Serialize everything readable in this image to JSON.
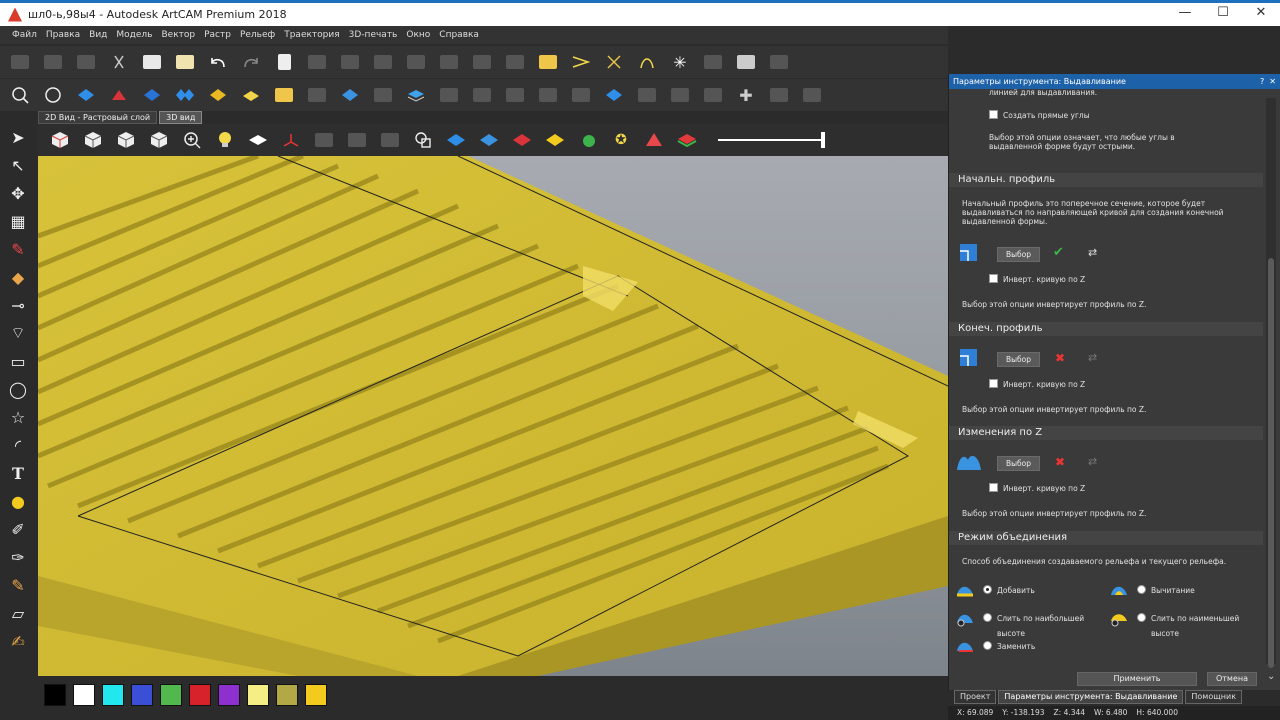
{
  "window": {
    "title": "шл0-ь,98ы4 - Autodesk ArtCAM Premium 2018",
    "minimize": "—",
    "maximize": "☐",
    "close": "✕"
  },
  "menu": [
    "Файл",
    "Правка",
    "Вид",
    "Модель",
    "Вектор",
    "Растр",
    "Рельеф",
    "Траектория",
    "3D-печать",
    "Окно",
    "Справка"
  ],
  "view_tabs": {
    "raster": "2D Вид - Растровый слой",
    "view3d": "3D вид"
  },
  "panel": {
    "title": "Параметры инструмента: Выдавливание",
    "help": "?",
    "close": "✕",
    "cut_text": "линией для выдавливания.",
    "sharp_corners": {
      "label": "Создать прямые углы",
      "desc": "Выбор этой опции означает, что любые углы в выдавленной форме будут острыми."
    },
    "start_profile": {
      "header": "Начальн. профиль",
      "desc": "Начальный профиль это поперечное сечение, которое будет выдавливаться по направляющей кривой для создания конечной выдавленной формы.",
      "select_label": "Выбор",
      "invert_label": "Инверт. кривую по Z",
      "invert_desc": "Выбор этой опции инвертирует профиль по Z."
    },
    "end_profile": {
      "header": "Конеч. профиль",
      "select_label": "Выбор",
      "invert_label": "Инверт. кривую по Z",
      "invert_desc": "Выбор этой опции инвертирует профиль по Z."
    },
    "z_changes": {
      "header": "Изменения по Z",
      "select_label": "Выбор",
      "invert_label": "Инверт. кривую по Z",
      "invert_desc": "Выбор этой опции инвертирует профиль по Z."
    },
    "combine": {
      "header": "Режим объединения",
      "desc": "Способ объединения создаваемого рельефа и текущего рельефа.",
      "add": "Добавить",
      "subtract": "Вычитание",
      "merge_high_1": "Слить по наибольшей",
      "merge_high_2": "высоте",
      "merge_low_1": "Слить по наименьшей",
      "merge_low_2": "высоте",
      "replace": "Заменить",
      "selected": "add"
    },
    "apply": "Применить",
    "cancel": "Отмена"
  },
  "panel_tabs": [
    "Проект",
    "Параметры инструмента: Выдавливание",
    "Помощник"
  ],
  "status": {
    "x": "X: 69.089",
    "y": "Y: -138.193",
    "z": "Z: 4.344",
    "w": "W: 6.480",
    "h": "H: 640.000"
  },
  "palette": [
    "#000000",
    "#ffffff",
    "#22e7ee",
    "#3a4fd6",
    "#52b84e",
    "#d8222b",
    "#8e2fd0",
    "#f4ee84",
    "#b3a846",
    "#f2cb1e"
  ],
  "colors": {
    "relief": "#d8c33a",
    "panel_title": "#1d62a8",
    "accent_ok": "#3bb54a",
    "accent_x": "#e33333"
  }
}
